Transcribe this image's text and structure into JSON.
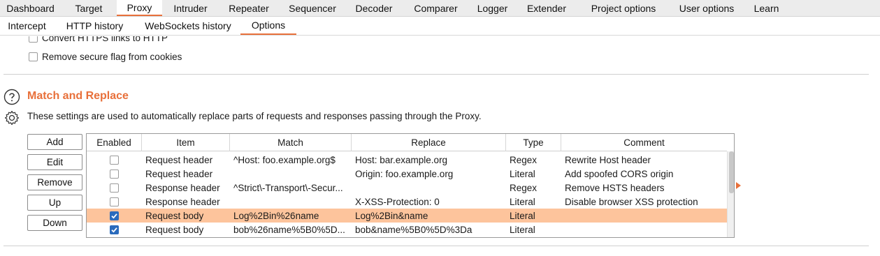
{
  "top_tabs": [
    "Dashboard",
    "Target",
    "Proxy",
    "Intruder",
    "Repeater",
    "Sequencer",
    "Decoder",
    "Comparer",
    "Logger",
    "Extender",
    "Project options",
    "User options",
    "Learn"
  ],
  "top_active": "Proxy",
  "sub_tabs": [
    "Intercept",
    "HTTP history",
    "WebSockets history",
    "Options"
  ],
  "sub_active": "Options",
  "checkboxes": {
    "convert_https": "Convert HTTPS links to HTTP",
    "remove_secure": "Remove secure flag from cookies"
  },
  "match_replace": {
    "title": "Match and Replace",
    "description": "These settings are used to automatically replace parts of requests and responses passing through the Proxy.",
    "buttons": [
      "Add",
      "Edit",
      "Remove",
      "Up",
      "Down"
    ],
    "columns": [
      "Enabled",
      "Item",
      "Match",
      "Replace",
      "Type",
      "Comment"
    ],
    "rows": [
      {
        "enabled": false,
        "item": "Request header",
        "match": "^Host: foo.example.org$",
        "replace": "Host: bar.example.org",
        "type": "Regex",
        "comment": "Rewrite Host header",
        "selected": false
      },
      {
        "enabled": false,
        "item": "Request header",
        "match": "",
        "replace": "Origin: foo.example.org",
        "type": "Literal",
        "comment": "Add spoofed CORS origin",
        "selected": false
      },
      {
        "enabled": false,
        "item": "Response header",
        "match": "^Strict\\-Transport\\-Secur...",
        "replace": "",
        "type": "Regex",
        "comment": "Remove HSTS headers",
        "selected": false
      },
      {
        "enabled": false,
        "item": "Response header",
        "match": "",
        "replace": "X-XSS-Protection: 0",
        "type": "Literal",
        "comment": "Disable browser XSS protection",
        "selected": false
      },
      {
        "enabled": true,
        "item": "Request body",
        "match": "Log%2Bin%26name",
        "replace": "Log%2Bin&name",
        "type": "Literal",
        "comment": "",
        "selected": true
      },
      {
        "enabled": true,
        "item": "Request body",
        "match": "bob%26name%5B0%5D...",
        "replace": "bob&name%5B0%5D%3Da",
        "type": "Literal",
        "comment": "",
        "selected": false
      }
    ]
  },
  "colors": {
    "accent": "#e8703a",
    "selected_row": "#fdc49c",
    "checkbox_checked": "#2a6bbd"
  }
}
